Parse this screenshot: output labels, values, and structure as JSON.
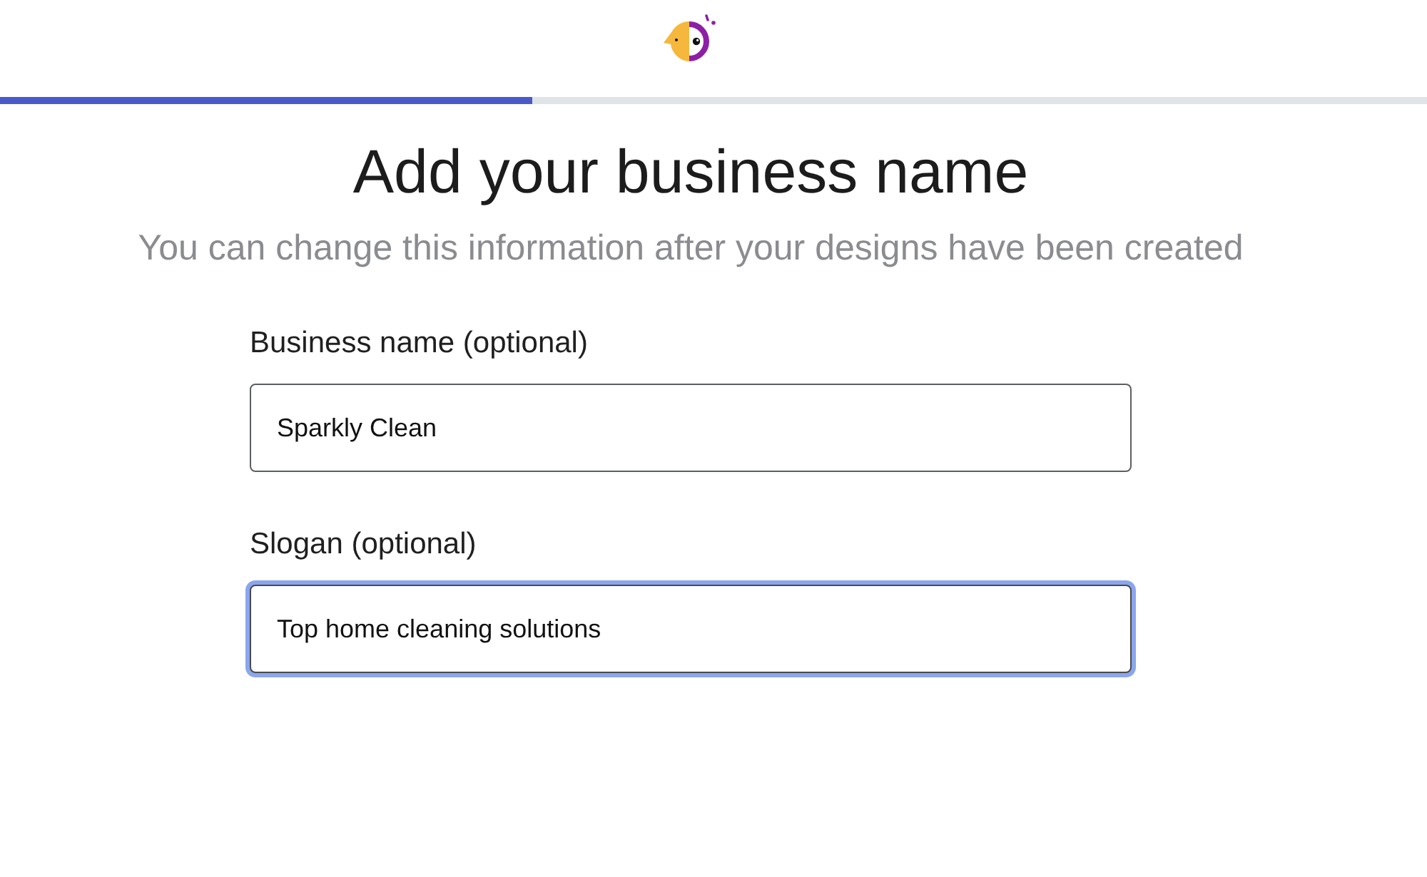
{
  "progress": {
    "level": 0.373
  },
  "heading": {
    "title": "Add your business name",
    "subtitle": "You can change this information after your designs have been created"
  },
  "fields": [
    {
      "label": "Business name (optional)",
      "value": "Sparkly Clean",
      "focused": false
    },
    {
      "label": "Slogan (optional)",
      "value": "Top home cleaning solutions",
      "focused": true
    }
  ]
}
